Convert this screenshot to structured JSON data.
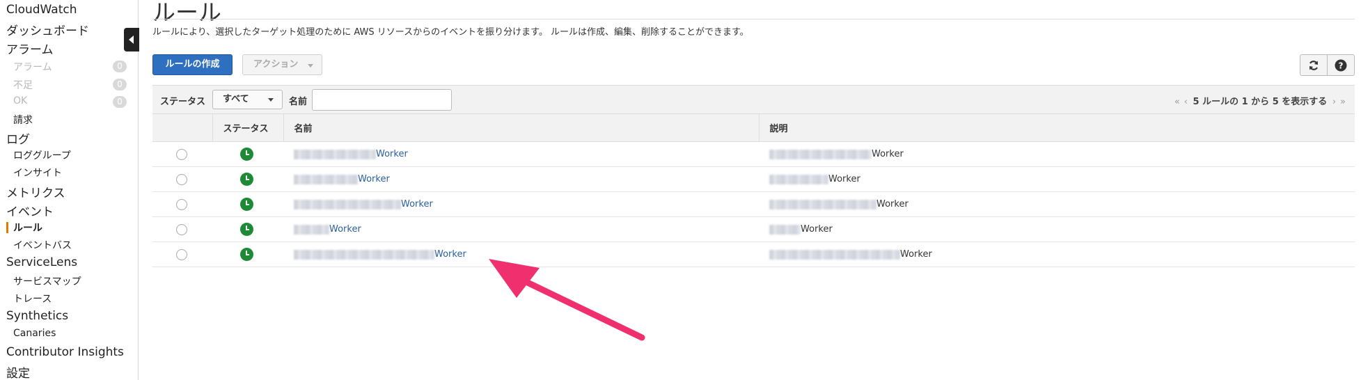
{
  "sidebar": {
    "cloudwatch": "CloudWatch",
    "dashboard": "ダッシュボード",
    "alarms_header": "アラーム",
    "alarm_sub": "アラーム",
    "alarm_count": "0",
    "insufficient": "不足",
    "insufficient_count": "0",
    "ok": "OK",
    "ok_count": "0",
    "billing": "請求",
    "logs": "ログ",
    "log_groups": "ロググループ",
    "insights": "インサイト",
    "metrics": "メトリクス",
    "events": "イベント",
    "rules": "ルール",
    "event_bus": "イベントバス",
    "servicelens": "ServiceLens",
    "service_map": "サービスマップ",
    "traces": "トレース",
    "synthetics": "Synthetics",
    "canaries": "Canaries",
    "contributor_insights": "Contributor Insights",
    "settings": "設定"
  },
  "main": {
    "title": "ルール",
    "description": "ルールにより、選択したターゲット処理のために AWS リソースからのイベントを振り分けます。 ルールは作成、編集、削除することができます。",
    "create_rule_label": "ルールの作成",
    "actions_label": "アクション"
  },
  "filter": {
    "status_label": "ステータス",
    "status_value": "すべて",
    "name_label": "名前",
    "name_value": ""
  },
  "pagination": {
    "text": "5 ルールの 1 から 5 を表示する"
  },
  "table": {
    "headers": {
      "status": "ステータス",
      "name": "名前",
      "description": "説明"
    },
    "rows": [
      {
        "status": "enabled",
        "name_suffix": "Worker",
        "desc_suffix": "Worker"
      },
      {
        "status": "enabled",
        "name_suffix": "Worker",
        "desc_suffix": "Worker"
      },
      {
        "status": "enabled",
        "name_suffix": "Worker",
        "desc_suffix": "Worker"
      },
      {
        "status": "enabled",
        "name_suffix": "Worker",
        "desc_suffix": "Worker"
      },
      {
        "status": "enabled",
        "name_suffix": "Worker",
        "desc_suffix": "Worker"
      }
    ]
  },
  "colors": {
    "primary_button": "#2e6fbf",
    "status_enabled": "#1d8a36",
    "link": "#2a5f9e",
    "annotation_arrow": "#f0306e",
    "sidebar_active_marker": "#e07b00"
  },
  "icons": {
    "refresh": "refresh-icon",
    "help": "help-icon",
    "collapse": "collapse-left-icon"
  }
}
